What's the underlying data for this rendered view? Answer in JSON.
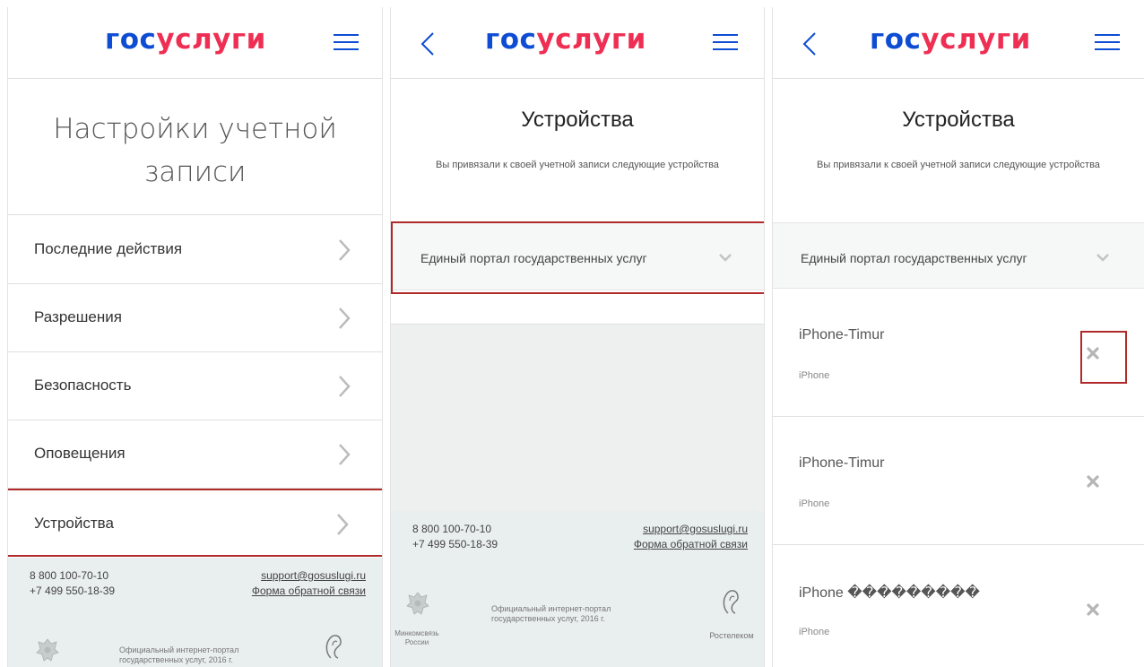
{
  "brand": {
    "part1": "гос",
    "part2": "услуги"
  },
  "panel1": {
    "title": "Настройки учетной записи",
    "menu": [
      {
        "label": "Последние действия"
      },
      {
        "label": "Разрешения"
      },
      {
        "label": "Безопасность"
      },
      {
        "label": "Оповещения"
      },
      {
        "label": "Устройства",
        "selected": true
      }
    ]
  },
  "devices_page": {
    "title": "Устройства",
    "subtitle": "Вы привязали к своей учетной записи следующие устройства",
    "section": "Единый портал государственных услуг"
  },
  "devices": [
    {
      "name": "iPhone-Timur",
      "type": "iPhone"
    },
    {
      "name": "iPhone-Timur",
      "type": "iPhone"
    },
    {
      "name": "iPhone ���������",
      "type": "iPhone"
    }
  ],
  "footer": {
    "phone1": "8 800 100-70-10",
    "phone2": "+7 499 550-18-39",
    "email": "support@gosuslugi.ru",
    "feedback": "Форма обратной связи",
    "official_line1": "Официальный интернет-портал",
    "official_line2": "государственных услуг, 2016 г.",
    "ministry_line1": "Минкомсвязь",
    "ministry_line2": "России",
    "rostelecom": "Ростелеком"
  },
  "colors": {
    "brand_blue": "#0d4cd3",
    "brand_red": "#ee2f53",
    "highlight": "#b02a2a"
  },
  "icons": [
    "menu-icon",
    "back-arrow-icon",
    "chevron-right-icon",
    "chevron-down-icon",
    "close-icon",
    "russia-emblem-icon",
    "rostelecom-logo-icon"
  ]
}
